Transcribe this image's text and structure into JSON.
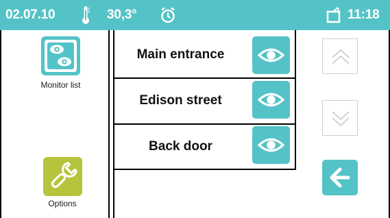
{
  "status_bar": {
    "date": "02.07.10",
    "temperature": "30,3°",
    "time": "11:18",
    "icons": [
      "thermometer-icon",
      "alarm-clock-icon",
      "message-icon"
    ]
  },
  "apps": [
    {
      "label": "Monitor list",
      "icon": "monitor-eyes-icon",
      "color": "#54c3c7"
    },
    {
      "label": "Options",
      "icon": "wrench-icon",
      "color": "#b5c43c"
    }
  ],
  "monitor_list": {
    "items": [
      {
        "label": "Main entrance",
        "icon": "eye-icon"
      },
      {
        "label": "Edison street",
        "icon": "eye-icon"
      },
      {
        "label": "Back door",
        "icon": "eye-icon"
      }
    ]
  },
  "navigation": {
    "scroll_up_icon": "chevron-up-icon",
    "scroll_down_icon": "chevron-down-icon",
    "back_icon": "arrow-left-icon"
  },
  "colors": {
    "accent": "#54c3c7",
    "options": "#b5c43c",
    "frame": "#000000"
  }
}
